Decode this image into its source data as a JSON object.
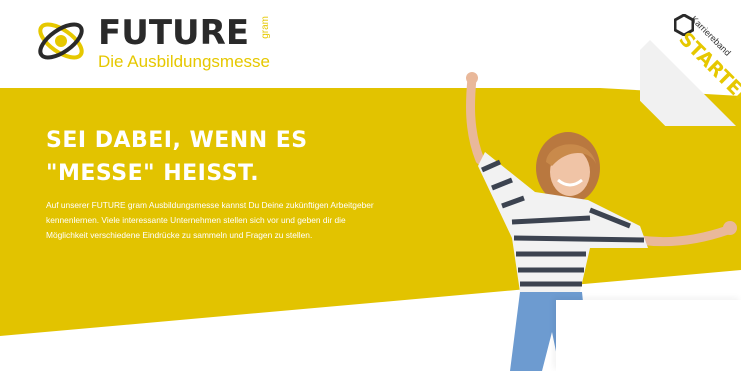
{
  "brand": {
    "name": "FUTURE",
    "suffix": "gram",
    "tagline": "Die Ausbildungsmesse",
    "logo_icon": "atom-orbit-logo-icon"
  },
  "ribbon": {
    "small_label": "Karriereband",
    "big_label": "STARTEN",
    "icon": "hexagon-icon"
  },
  "hero": {
    "title_line1": "SEI DABEI, WENN ES",
    "title_line2": "\"MESSE\" HEISST.",
    "body": "Auf unserer FUTURE gram Ausbildungsmesse kannst Du Deine zukünftigen Arbeitgeber kennenlernen. Viele interessante Unternehmen stellen sich vor und geben dir die Möglichkeit verschiedene Eindrücke zu sammeln und Fragen zu stellen."
  },
  "colors": {
    "brand_yellow": "#e6c800",
    "band_yellow": "#e2c300",
    "text_dark": "#2a2a2a",
    "white": "#ffffff"
  }
}
